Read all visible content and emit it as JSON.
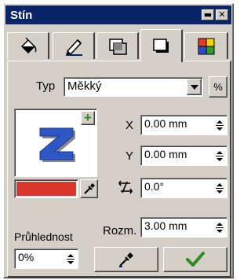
{
  "window": {
    "title": "Stín"
  },
  "titlebar_buttons": {
    "minimize": "▬",
    "close": "✕"
  },
  "tabs": [
    {
      "icon": "fill-bucket-icon"
    },
    {
      "icon": "pen-icon"
    },
    {
      "icon": "transparency-icon"
    },
    {
      "icon": "shadow-icon",
      "active": true
    },
    {
      "icon": "color-palette-icon"
    }
  ],
  "type_row": {
    "label": "Typ",
    "value": "Měkký",
    "percent_label": "%"
  },
  "preview": {
    "letter": "Z",
    "add_label": "+"
  },
  "color": {
    "swatch": "#d9362c"
  },
  "offset_x": {
    "label": "X",
    "value": "0.00 mm"
  },
  "offset_y": {
    "label": "Y",
    "value": "0.00 mm"
  },
  "angle": {
    "value": "0.0°"
  },
  "size": {
    "label": "Rozm.",
    "value": "3.00 mm"
  },
  "transparency": {
    "label": "Průhlednost",
    "value": "0%"
  },
  "colors": {
    "titlebar": "#0a246a",
    "face": "#d4d0c8",
    "z_letter": "#2e56c5",
    "check": "#2e8b1f"
  }
}
